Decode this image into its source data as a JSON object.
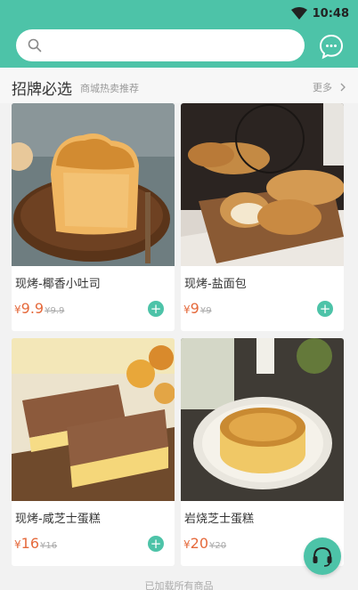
{
  "status": {
    "time": "10:48"
  },
  "search": {
    "placeholder": "",
    "value": ""
  },
  "section": {
    "title": "招牌必选",
    "subtitle": "商城热卖推荐",
    "more_label": "更多"
  },
  "products": [
    {
      "name": "现烤-椰香小吐司",
      "currency": "¥",
      "price": "9.9",
      "original_price": "¥9.9"
    },
    {
      "name": "现烤-盐面包",
      "currency": "¥",
      "price": "9",
      "original_price": "¥9"
    },
    {
      "name": "现烤-咸芝士蛋糕",
      "currency": "¥",
      "price": "16",
      "original_price": "¥16"
    },
    {
      "name": "岩烧芝士蛋糕",
      "currency": "¥",
      "price": "20",
      "original_price": "¥20"
    }
  ],
  "footer": {
    "loaded_text": "已加载所有商品"
  },
  "colors": {
    "accent": "#4dc3a8",
    "price": "#e56a3c"
  },
  "icons": [
    "wifi-icon",
    "search-icon",
    "chat-icon",
    "chevron-right-icon",
    "plus-icon",
    "headset-icon"
  ]
}
